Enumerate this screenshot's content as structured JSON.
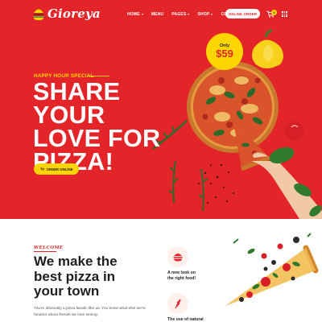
{
  "brand": {
    "name": "Gioreya",
    "icon": "burger-logo-icon"
  },
  "nav": {
    "items": [
      {
        "label": "HOME",
        "dropdown": true
      },
      {
        "label": "MENU",
        "dropdown": false
      },
      {
        "label": "PAGES",
        "dropdown": true
      },
      {
        "label": "SHOP",
        "dropdown": true
      },
      {
        "label": "CONTACT",
        "dropdown": false
      }
    ],
    "order_button": "ONLINE ORDER",
    "cart_count": "0",
    "cart_icon": "cart-icon",
    "menu_icon": "grid-menu-icon"
  },
  "hero": {
    "eyebrow": "HAPPY HOUR SPECIAL",
    "headline_line1": "SHARE YOUR",
    "headline_line2": "LOVE FOR",
    "headline_line3": "PIZZA!",
    "cta": "ORDER ONLINE",
    "price_label": "Only",
    "price_value": "$59"
  },
  "welcome": {
    "label": "WELCOME",
    "title_line1": "We make the",
    "title_line2": "best pizza in",
    "title_line3": "your town",
    "text_line1": "You're obviously a pizza fanatic like us. You know what else we're",
    "text_line2": "fanatics about friends we love seeing."
  },
  "features": [
    {
      "icon": "burger-icon",
      "line1": "A new look on",
      "line2": "the right food!"
    },
    {
      "icon": "wheat-icon",
      "line1": "The use of natural",
      "line2": ""
    }
  ],
  "colors": {
    "brand_red": "#e32529",
    "accent_yellow": "#ffd500",
    "dark_text": "#1e1e1e"
  }
}
